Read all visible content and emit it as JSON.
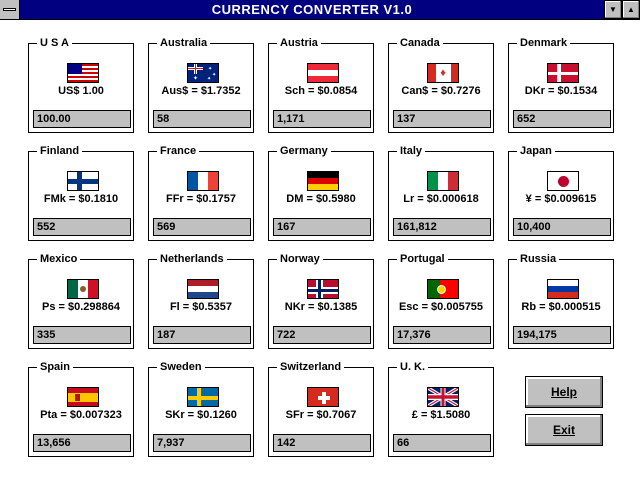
{
  "window": {
    "title": "CURRENCY CONVERTER  V1.0"
  },
  "countries": [
    {
      "name": "U S A",
      "rate": "US$ 1.00",
      "amount": "100.00"
    },
    {
      "name": "Australia",
      "rate": "Aus$ = $1.7352",
      "amount": "58"
    },
    {
      "name": "Austria",
      "rate": "Sch = $0.0854",
      "amount": "1,171"
    },
    {
      "name": "Canada",
      "rate": "Can$ = $0.7276",
      "amount": "137"
    },
    {
      "name": "Denmark",
      "rate": "DKr = $0.1534",
      "amount": "652"
    },
    {
      "name": "Finland",
      "rate": "FMk = $0.1810",
      "amount": "552"
    },
    {
      "name": "France",
      "rate": "FFr = $0.1757",
      "amount": "569"
    },
    {
      "name": "Germany",
      "rate": "DM = $0.5980",
      "amount": "167"
    },
    {
      "name": "Italy",
      "rate": "Lr = $0.000618",
      "amount": "161,812"
    },
    {
      "name": "Japan",
      "rate": "¥ = $0.009615",
      "amount": "10,400"
    },
    {
      "name": "Mexico",
      "rate": "Ps = $0.298864",
      "amount": "335"
    },
    {
      "name": "Netherlands",
      "rate": "Fl = $0.5357",
      "amount": "187"
    },
    {
      "name": "Norway",
      "rate": "NKr = $0.1385",
      "amount": "722"
    },
    {
      "name": "Portugal",
      "rate": "Esc = $0.005755",
      "amount": "17,376"
    },
    {
      "name": "Russia",
      "rate": "Rb = $0.000515",
      "amount": "194,175"
    },
    {
      "name": "Spain",
      "rate": "Pta = $0.007323",
      "amount": "13,656"
    },
    {
      "name": "Sweden",
      "rate": "SKr = $0.1260",
      "amount": "7,937"
    },
    {
      "name": "Switzerland",
      "rate": "SFr = $0.7067",
      "amount": "142"
    },
    {
      "name": "U. K.",
      "rate": "£ = $1.5080",
      "amount": "66"
    }
  ],
  "buttons": {
    "help": "Help",
    "exit": "Exit"
  },
  "colors": {
    "titlebar": "#000080",
    "field": "#c0c0c0",
    "button": "#c0c0c0"
  },
  "icons": {
    "system_menu": "system-menu-icon",
    "minimize": "minimize-arrow-icon",
    "maximize": "maximize-arrow-icon"
  }
}
